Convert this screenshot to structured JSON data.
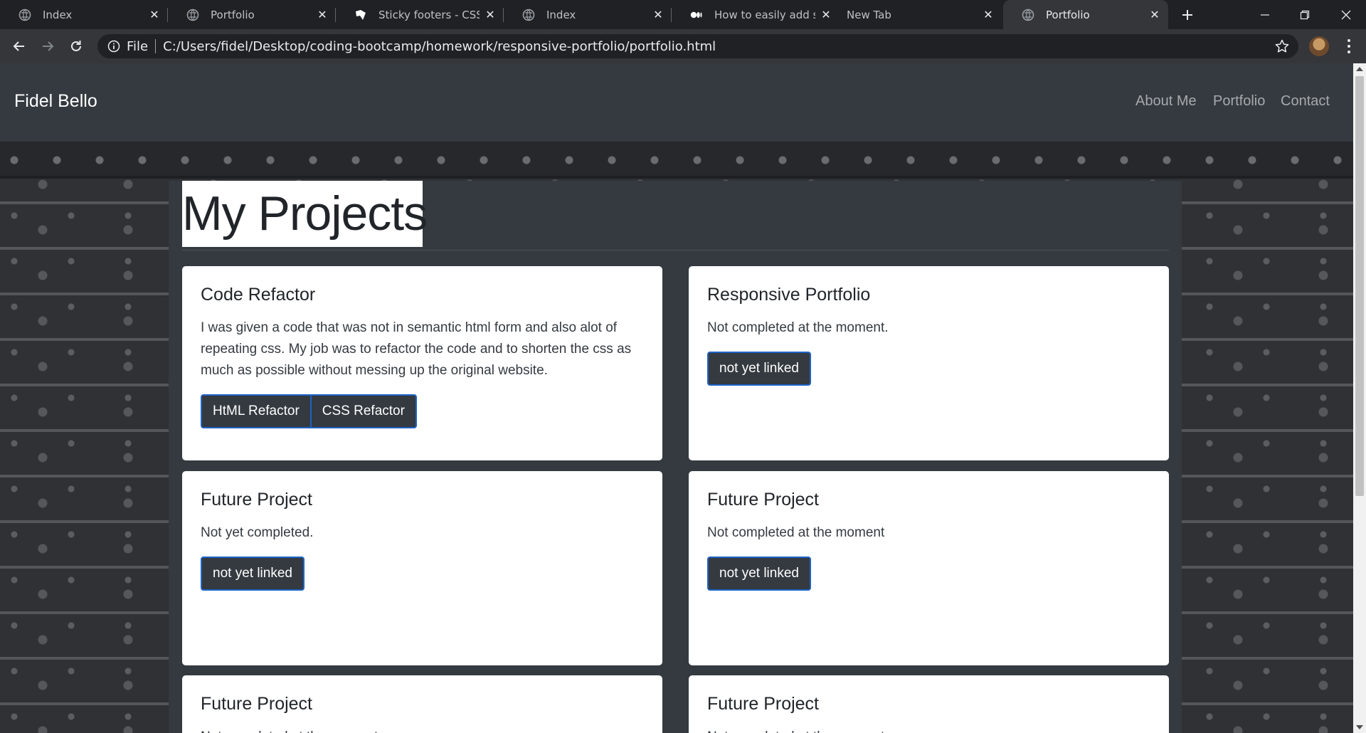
{
  "browser": {
    "tabs": [
      {
        "title": "Index",
        "icon": "globe-icon"
      },
      {
        "title": "Portfolio",
        "icon": "globe-icon"
      },
      {
        "title": "Sticky footers - CSS: Ca",
        "icon": "mdn-icon"
      },
      {
        "title": "Index",
        "icon": "globe-icon"
      },
      {
        "title": "How to easily add scre",
        "icon": "medium-icon"
      },
      {
        "title": "New Tab",
        "icon": ""
      },
      {
        "title": "Portfolio",
        "icon": "globe-icon",
        "active": true
      }
    ],
    "omnibox": {
      "scheme_label": "File",
      "url": "C:/Users/fidel/Desktop/coding-bootcamp/homework/responsive-portfolio/portfolio.html"
    }
  },
  "site": {
    "brand": "Fidel Bello",
    "nav": [
      "About Me",
      "Portfolio",
      "Contact"
    ],
    "heading": "My Projects",
    "cards": [
      {
        "title": "Code Refactor",
        "text": "I was given a code that was not in semantic html form and also alot of repeating css. My job was to refactor the code and to shorten the css as much as possible without messing up the original website.",
        "buttons": [
          "HtML Refactor",
          "CSS Refactor"
        ]
      },
      {
        "title": "Responsive Portfolio",
        "text": "Not completed at the moment.",
        "buttons": [
          "not yet linked"
        ]
      },
      {
        "title": "Future Project",
        "text": "Not yet completed.",
        "buttons": [
          "not yet linked"
        ]
      },
      {
        "title": "Future Project",
        "text": "Not completed at the moment",
        "buttons": [
          "not yet linked"
        ]
      },
      {
        "title": "Future Project",
        "text": "Not completed at the moment",
        "buttons": []
      },
      {
        "title": "Future Project",
        "text": "Not completed at the moment",
        "buttons": []
      }
    ]
  },
  "colors": {
    "navbar_bg": "#343a40",
    "button_border": "#1f63c6",
    "chrome_tab_bg": "#202124",
    "chrome_active_tab": "#35363a"
  }
}
